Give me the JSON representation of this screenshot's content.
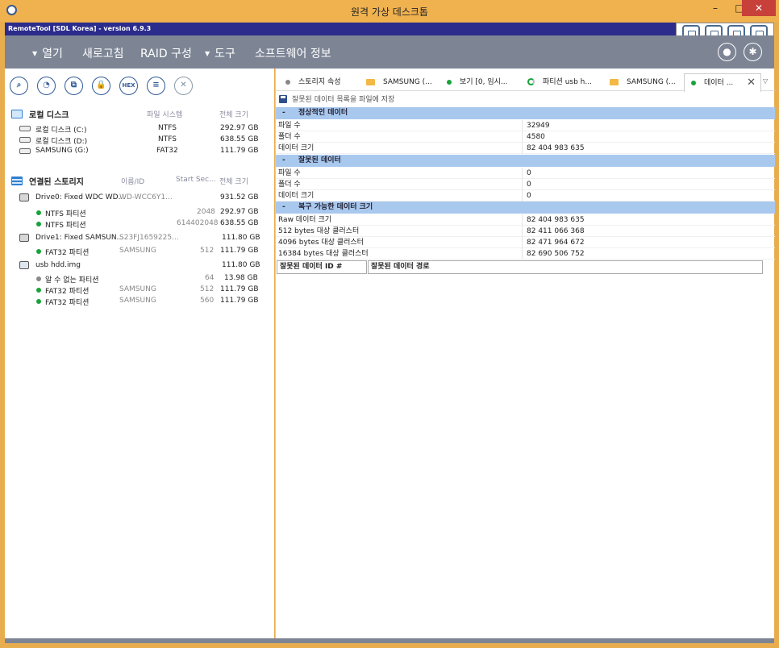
{
  "window": {
    "title": "원격 가상 데스크톱",
    "minimize": "–",
    "maximize": "□",
    "close": "✕"
  },
  "remote_bar": {
    "label": "RemoteTool [SDL Korea] - version 6.9.3",
    "icons": [
      "monitor-sync-icon",
      "window-enter-icon",
      "window-exit-icon",
      "screen-list-icon"
    ]
  },
  "menu": {
    "open": "열기",
    "refresh": "새로고침",
    "raid": "RAID 구성",
    "tools": "도구",
    "about": "소프트웨어 정보",
    "user_icon": "user-icon",
    "settings_icon": "gear-icon"
  },
  "toolbar": {
    "search": "⌕",
    "scan": "◔",
    "image": "⧉",
    "lock": "🔒",
    "hex": "HEX",
    "list": "≡",
    "close": "✕"
  },
  "local_disks": {
    "title": "로컬 디스크",
    "col_fs": "파일 시스템",
    "col_size": "전체 크기",
    "items": [
      {
        "name": "로컬 디스크 (C:)",
        "fs": "NTFS",
        "size": "292.97 GB"
      },
      {
        "name": "로컬 디스크 (D:)",
        "fs": "NTFS",
        "size": "638.55 GB"
      },
      {
        "name": "SAMSUNG (G:)",
        "fs": "FAT32",
        "size": "111.79 GB"
      }
    ]
  },
  "storage": {
    "title": "연결된 스토리지",
    "col_name": "이름/ID",
    "col_start": "Start Sec...",
    "col_size": "전체 크기",
    "drive0": {
      "name": "Drive0: Fixed WDC WD...",
      "id": "WD-WCC6Y1...",
      "size": "931.52 GB"
    },
    "drive0_parts": [
      {
        "name": "NTFS 파티션",
        "start": "2048",
        "size": "292.97 GB"
      },
      {
        "name": "NTFS 파티션",
        "start": "614402048",
        "size": "638.55 GB"
      }
    ],
    "drive1": {
      "name": "Drive1: Fixed SAMSUN...",
      "id": "S23FJ1659225...",
      "size": "111.80 GB"
    },
    "drive1_parts": [
      {
        "name": "FAT32 파티션",
        "id": "SAMSUNG",
        "start": "512",
        "size": "111.79 GB"
      }
    ],
    "usb": {
      "name": "usb hdd.img",
      "size": "111.80 GB"
    },
    "usb_parts": [
      {
        "name": "알 수 없는 파티션",
        "id": "",
        "start": "64",
        "size": "13.98 GB"
      },
      {
        "name": "FAT32 파티션",
        "id": "SAMSUNG",
        "start": "512",
        "size": "111.79 GB"
      },
      {
        "name": "FAT32 파티션",
        "id": "SAMSUNG",
        "start": "560",
        "size": "111.79 GB"
      }
    ]
  },
  "tabs": [
    {
      "label": "스토리지 속성"
    },
    {
      "label": "SAMSUNG (..."
    },
    {
      "label": "보기 [0, 임시..."
    },
    {
      "label": "파티션 usb h..."
    },
    {
      "label": "SAMSUNG (..."
    },
    {
      "label": "데이터 ..."
    }
  ],
  "tab_close": "✕",
  "tab_menu": "▽",
  "save_label": "잘못된 데이터 목록을 파일에 저장",
  "groups": {
    "normal": {
      "dash": "-",
      "title": "정상적인 데이터",
      "rows": [
        {
          "k": "파일 수",
          "v": "32949"
        },
        {
          "k": "폴더 수",
          "v": "4580"
        },
        {
          "k": "데이터 크기",
          "v": "82 404 983 635"
        }
      ]
    },
    "bad": {
      "dash": "-",
      "title": "잘못된 데이터",
      "rows": [
        {
          "k": "파일 수",
          "v": "0"
        },
        {
          "k": "폴더 수",
          "v": "0"
        },
        {
          "k": "데이터 크기",
          "v": "0"
        }
      ]
    },
    "recoverable": {
      "dash": "-",
      "title": "복구 가능한 데이터 크기",
      "rows": [
        {
          "k": "Raw 데이터 크기",
          "v": "82 404 983 635"
        },
        {
          "k": "512 bytes 대상 클러스터",
          "v": "82 411 066 368"
        },
        {
          "k": "4096 bytes 대상 클러스터",
          "v": "82 471 964 672"
        },
        {
          "k": "16384 bytes 대상 클러스터",
          "v": "82 690 506 752"
        }
      ]
    }
  },
  "grid": {
    "col_id": "잘못된 데이터 ID #",
    "col_path": "잘못된 데이터 경로"
  }
}
